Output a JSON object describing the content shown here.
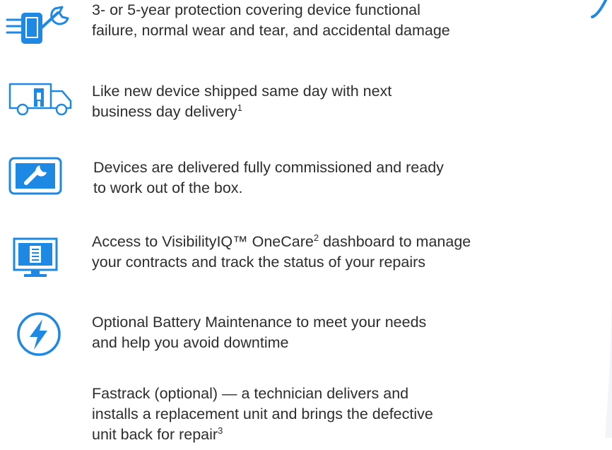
{
  "accent_color": "#1e88e5",
  "features": [
    {
      "icon": "phone-wrench-icon",
      "lines": [
        "3- or 5-year protection covering device functional",
        "failure, normal wear and tear, and accidental damage"
      ]
    },
    {
      "icon": "delivery-truck-icon",
      "lines": [
        "Like new device shipped same day with next",
        "business day delivery"
      ],
      "superscript": "1"
    },
    {
      "icon": "wrench-screen-icon",
      "lines": [
        "Devices are delivered fully commissioned and ready",
        "to work out of the box."
      ]
    },
    {
      "icon": "monitor-dashboard-icon",
      "line1_before": "Access to VisibilityIQ™ OneCare",
      "line1_superscript": "2",
      "line1_after": " dashboard to manage",
      "lines": [
        "your contracts and track the status of your repairs"
      ]
    },
    {
      "icon": "lightning-bolt-icon",
      "lines": [
        "Optional Battery Maintenance to meet your needs",
        "and help you avoid downtime"
      ]
    },
    {
      "icon": "",
      "lines": [
        "Fastrack (optional) — a technician delivers and",
        "installs a replacement unit and brings the defective",
        "unit back for repair"
      ],
      "superscript": "3"
    }
  ]
}
